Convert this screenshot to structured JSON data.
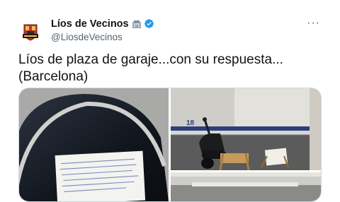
{
  "author": {
    "display_name": "Líos de Vecinos",
    "handle": "@LiosdeVecinos",
    "name_emoji": "building-emoji",
    "verified_icon": "verified-badge-icon",
    "verified_color": "#1d9bf0"
  },
  "more_icon": "more-options-icon",
  "more_label": "···",
  "tweet": {
    "lines": [
      "Líos de plaza de garaje...con su respuesta...",
      "(Barcelona)"
    ]
  },
  "media": {
    "photos": [
      {
        "description_icon": "photo-note-on-car-window"
      },
      {
        "description_icon": "photo-motorcycle-garage-with-chair"
      },
      {
        "description_icon": "photo-garage-floor"
      }
    ],
    "garage_spot_number": "18"
  },
  "colors": {
    "text": "#0f1419",
    "secondary": "#536471",
    "border": "#cfd9de",
    "garage_stripe": "#2b3f7a"
  }
}
